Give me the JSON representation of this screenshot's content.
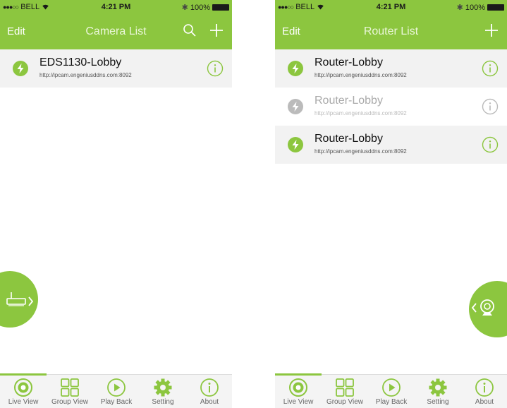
{
  "colors": {
    "accent": "#8cc63f",
    "dim_icon": "#bbbbbb"
  },
  "status_bar": {
    "carrier": "BELL",
    "time": "4:21 PM",
    "battery": "100%"
  },
  "left": {
    "nav": {
      "edit": "Edit",
      "title": "Camera List"
    },
    "rows": [
      {
        "name": "EDS1130-Lobby",
        "url": "http://ipcam.engeniusddns.com:8092"
      }
    ],
    "fab_icon": "router-forward-icon"
  },
  "right": {
    "nav": {
      "edit": "Edit",
      "title": "Router List"
    },
    "rows": [
      {
        "name": "Router-Lobby",
        "url": "http://ipcam.engeniusddns.com:8092"
      },
      {
        "name": "Router-Lobby",
        "url": "http://ipcam.engeniusddns.com:8092"
      },
      {
        "name": "Router-Lobby",
        "url": "http://ipcam.engeniusddns.com:8092"
      }
    ],
    "fab_icon": "camera-back-icon"
  },
  "tabs": [
    {
      "label": "Live View",
      "icon": "live-view-icon"
    },
    {
      "label": "Group View",
      "icon": "group-view-icon"
    },
    {
      "label": "Play Back",
      "icon": "play-back-icon"
    },
    {
      "label": "Setting",
      "icon": "gear-icon"
    },
    {
      "label": "About",
      "icon": "info-icon"
    }
  ]
}
